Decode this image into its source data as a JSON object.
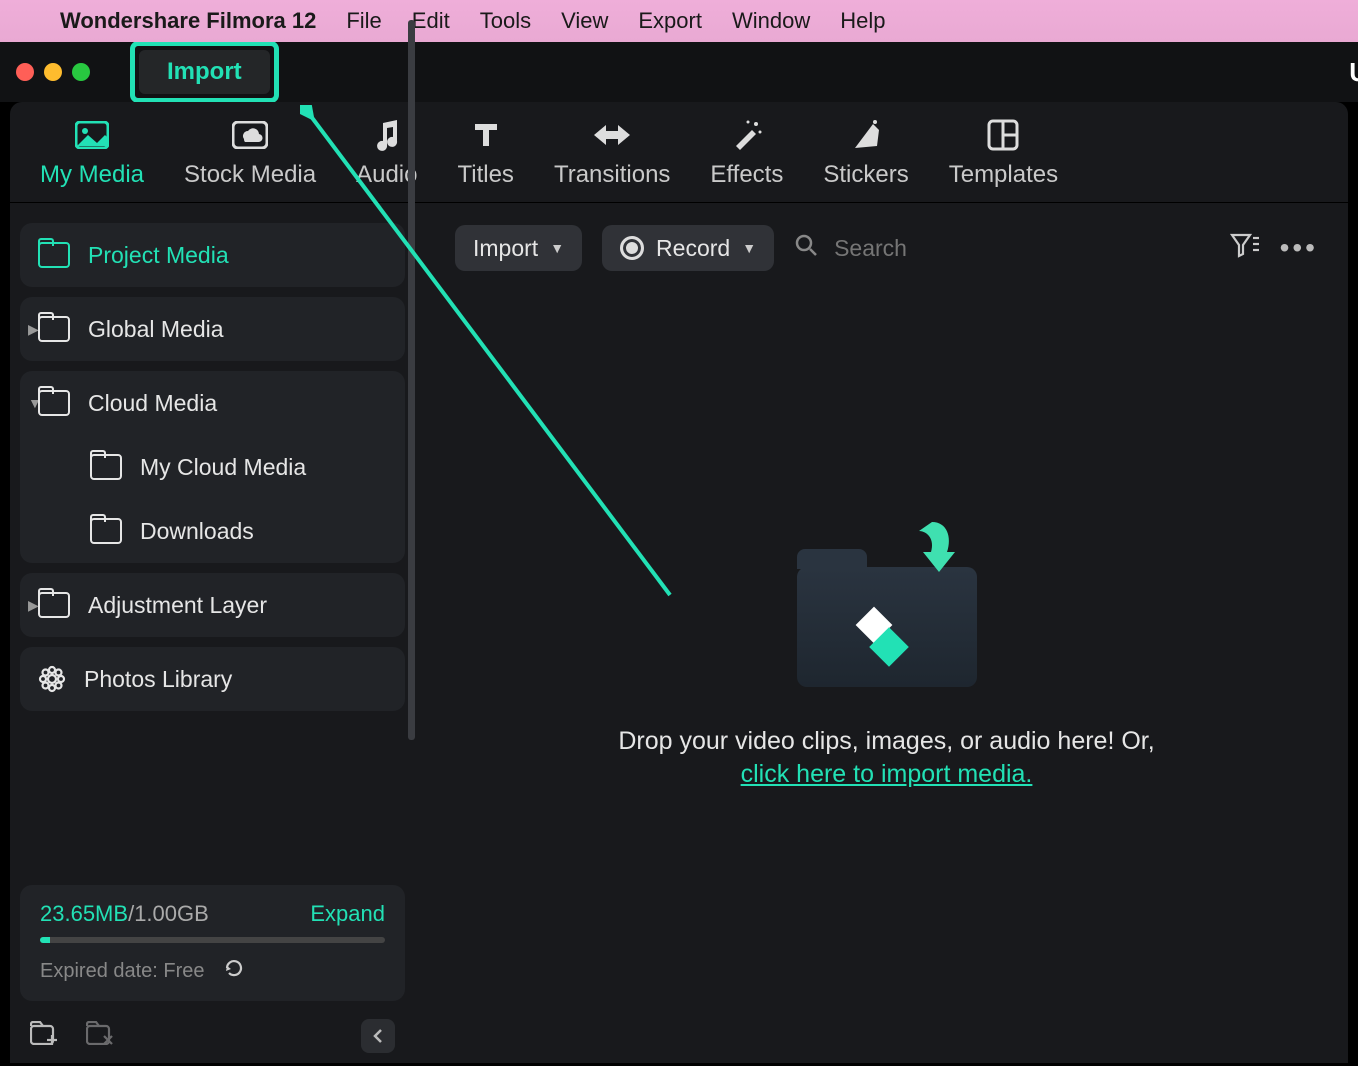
{
  "menubar": {
    "app": "Wondershare Filmora 12",
    "items": [
      "File",
      "Edit",
      "Tools",
      "View",
      "Export",
      "Window",
      "Help"
    ]
  },
  "titlebar": {
    "import_label": "Import",
    "right_text": "U"
  },
  "tabs": {
    "items": [
      {
        "label": "My Media"
      },
      {
        "label": "Stock Media"
      },
      {
        "label": "Audio"
      },
      {
        "label": "Titles"
      },
      {
        "label": "Transitions"
      },
      {
        "label": "Effects"
      },
      {
        "label": "Stickers"
      },
      {
        "label": "Templates"
      }
    ]
  },
  "sidebar": {
    "items": [
      {
        "label": "Project Media"
      },
      {
        "label": "Global Media"
      },
      {
        "label": "Cloud Media"
      },
      {
        "label": "My Cloud Media"
      },
      {
        "label": "Downloads"
      },
      {
        "label": "Adjustment Layer"
      },
      {
        "label": "Photos Library"
      }
    ],
    "storage": {
      "used": "23.65MB",
      "sep": "/",
      "total": "1.00GB",
      "expand": "Expand",
      "expired": "Expired date: Free"
    }
  },
  "toolbar": {
    "import": "Import",
    "record": "Record",
    "search_placeholder": "Search"
  },
  "drop": {
    "text": "Drop your video clips, images, or audio here! Or,",
    "link": "click here to import media."
  }
}
